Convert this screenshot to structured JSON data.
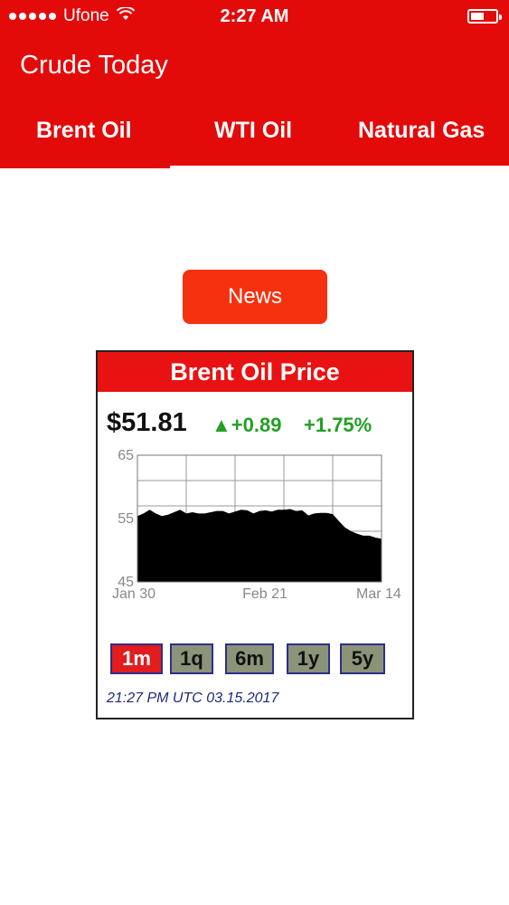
{
  "status_bar": {
    "carrier": "Ufone",
    "time": "2:27 AM"
  },
  "app": {
    "title": "Crude Today"
  },
  "tabs": [
    {
      "label": "Brent Oil",
      "selected": true
    },
    {
      "label": "WTI Oil",
      "selected": false
    },
    {
      "label": "Natural Gas",
      "selected": false
    }
  ],
  "news_button": {
    "label": "News"
  },
  "card": {
    "title": "Brent Oil Price",
    "price": "$51.81",
    "change": "▲+0.89",
    "change_pct": "+1.75%",
    "timestamp": "21:27 PM UTC 03.15.2017",
    "ranges": [
      {
        "label": "1m",
        "active": true
      },
      {
        "label": "1q",
        "active": false
      },
      {
        "label": "6m",
        "active": false
      },
      {
        "label": "1y",
        "active": false
      },
      {
        "label": "5y",
        "active": false
      }
    ]
  },
  "colors": {
    "header": "#e30a0a",
    "news_button": "#f5310f",
    "positive": "#22a022",
    "active_range": "#e11d1d",
    "inactive_range": "#8b9378"
  },
  "chart_data": {
    "type": "area",
    "yticks": [
      "65",
      "55",
      "45"
    ],
    "ylim": [
      45,
      65
    ],
    "xticks": [
      "Jan 30",
      "Feb 21",
      "Mar 14"
    ],
    "x": [
      0,
      1,
      2,
      3,
      4,
      5,
      6,
      7,
      8,
      9,
      10,
      11,
      12,
      13,
      14,
      15,
      16,
      17,
      18,
      19,
      20,
      21,
      22,
      23,
      24,
      25,
      26,
      27,
      28,
      29,
      30,
      31,
      32,
      33,
      34,
      35,
      36,
      37,
      38,
      39,
      40
    ],
    "y": [
      55.4,
      55.8,
      56.4,
      55.8,
      55.4,
      55.6,
      56.0,
      56.4,
      55.8,
      56.0,
      55.8,
      55.8,
      56.0,
      56.2,
      56.2,
      55.8,
      56.1,
      56.4,
      56.3,
      55.8,
      56.2,
      56.3,
      56.1,
      56.4,
      56.4,
      56.5,
      56.2,
      56.3,
      55.5,
      55.8,
      55.9,
      55.9,
      55.7,
      54.6,
      53.6,
      53.0,
      52.6,
      52.3,
      52.3,
      52.0,
      51.8
    ],
    "grid": true
  }
}
